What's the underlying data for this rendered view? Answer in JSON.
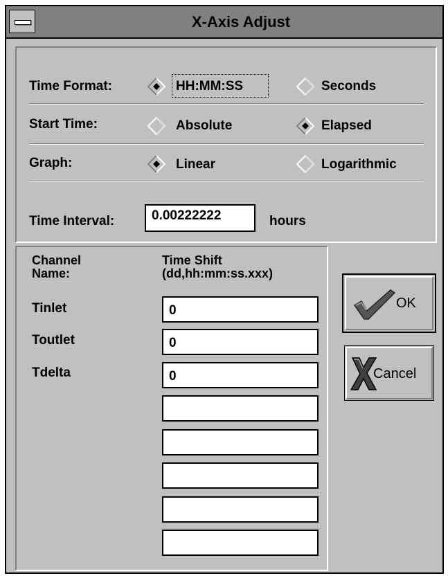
{
  "window": {
    "title": "X-Axis Adjust"
  },
  "time_format": {
    "label": "Time Format:",
    "options": [
      {
        "label": "HH:MM:SS",
        "selected": true
      },
      {
        "label": "Seconds",
        "selected": false
      }
    ]
  },
  "start_time": {
    "label": "Start Time:",
    "options": [
      {
        "label": "Absolute",
        "selected": false
      },
      {
        "label": "Elapsed",
        "selected": true
      }
    ]
  },
  "graph": {
    "label": "Graph:",
    "options": [
      {
        "label": "Linear",
        "selected": true
      },
      {
        "label": "Logarithmic",
        "selected": false
      }
    ]
  },
  "time_interval": {
    "label": "Time Interval:",
    "value": "0.00222222",
    "unit": "hours"
  },
  "channels": {
    "name_header_line1": "Channel",
    "name_header_line2": "Name:",
    "shift_header_line1": "Time Shift",
    "shift_header_line2": "(dd,hh:mm:ss.xxx)",
    "rows": [
      {
        "name": "Tinlet",
        "shift": "0"
      },
      {
        "name": "Toutlet",
        "shift": "0"
      },
      {
        "name": "Tdelta",
        "shift": "0"
      },
      {
        "name": "",
        "shift": ""
      },
      {
        "name": "",
        "shift": ""
      },
      {
        "name": "",
        "shift": ""
      },
      {
        "name": "",
        "shift": ""
      },
      {
        "name": "",
        "shift": ""
      }
    ]
  },
  "buttons": {
    "ok_label": "OK",
    "cancel_label": "Cancel"
  },
  "colors": {
    "face": "#c0c0c0",
    "title_bar": "#808080",
    "highlight": "#ffffff",
    "shadow": "#808080",
    "check_mark": "#555555",
    "cancel_x": "#404040"
  }
}
